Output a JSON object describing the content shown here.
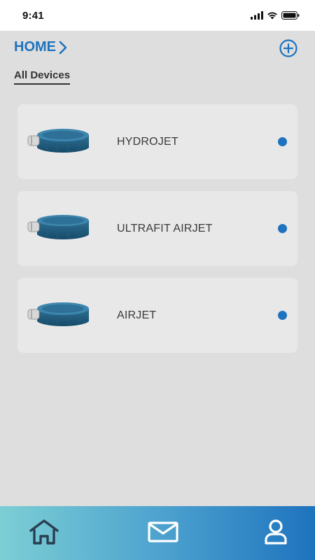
{
  "status_bar": {
    "time": "9:41"
  },
  "header": {
    "home_label": "HOME"
  },
  "section": {
    "tab_label": "All Devices"
  },
  "devices": [
    {
      "name": "HYDROJET",
      "status_color": "#1e73be"
    },
    {
      "name": "ULTRAFIT AIRJET",
      "status_color": "#1e73be"
    },
    {
      "name": "AIRJET",
      "status_color": "#1e73be"
    }
  ],
  "bottom_nav": {
    "items": [
      {
        "icon": "home-icon"
      },
      {
        "icon": "mail-icon"
      },
      {
        "icon": "profile-icon"
      }
    ]
  },
  "colors": {
    "accent": "#1e73be",
    "background": "#dedede",
    "card": "#e8e8e8",
    "nav_gradient_start": "#7ccfd4",
    "nav_gradient_end": "#1e73be"
  }
}
